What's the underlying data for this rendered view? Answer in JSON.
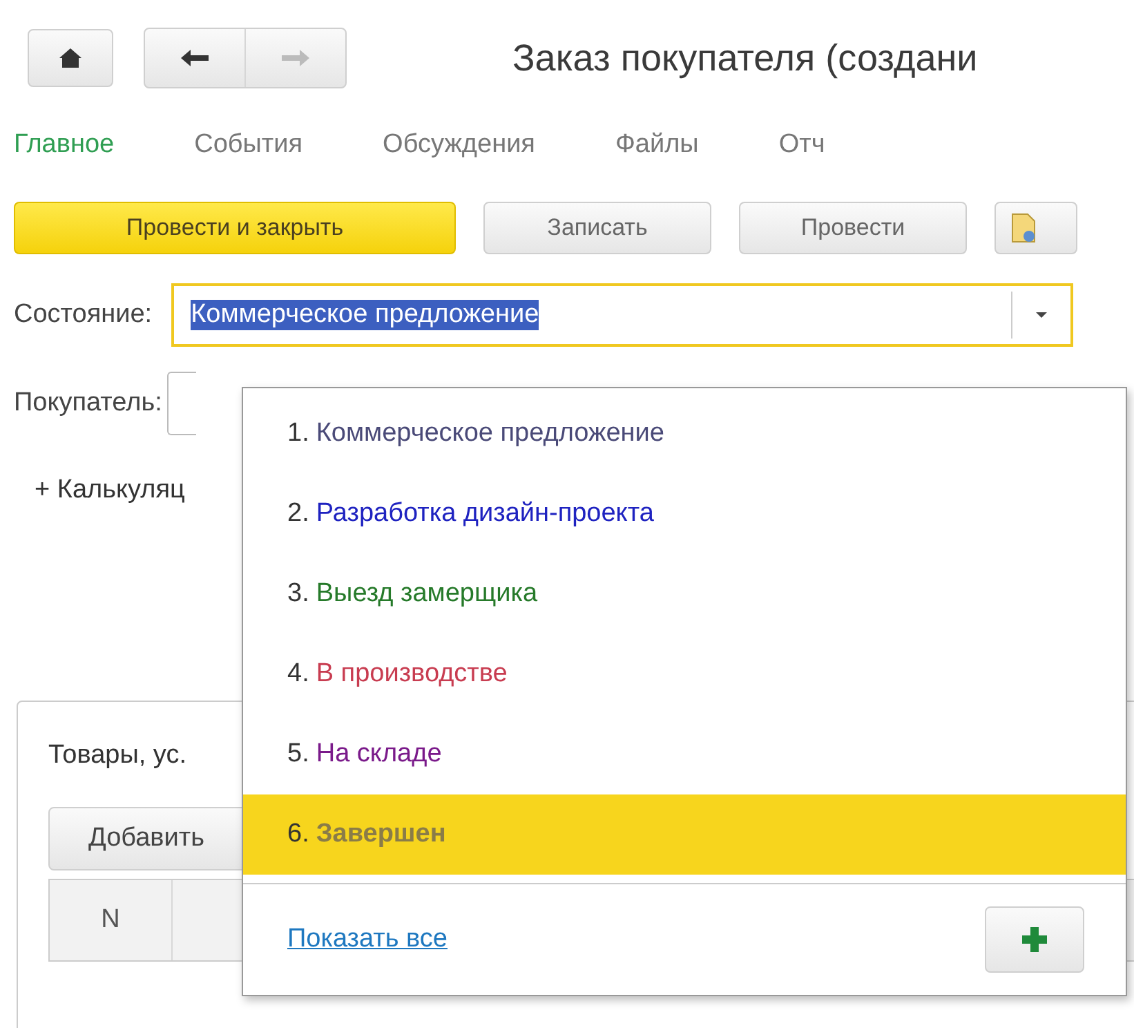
{
  "window": {
    "title": "Заказ покупателя (создани"
  },
  "nav": [
    {
      "label": "Главное",
      "selected": true
    },
    {
      "label": "События",
      "selected": false
    },
    {
      "label": "Обсуждения",
      "selected": false
    },
    {
      "label": "Файлы",
      "selected": false
    },
    {
      "label": "Отч",
      "selected": false
    }
  ],
  "toolbar": [
    {
      "label": "Провести и закрыть",
      "kind": "primary"
    },
    {
      "label": "Записать",
      "kind": "plain"
    },
    {
      "label": "Провести",
      "kind": "plain"
    },
    {
      "kind": "icon"
    }
  ],
  "state_field": {
    "label": "Состояние:",
    "value": "Коммерческое предложение"
  },
  "customer_field": {
    "label": "Покупатель:"
  },
  "calc_link": "+ Калькуляц",
  "panel": {
    "tab": "Товары, ус.",
    "add_button": "Добавить",
    "columns": [
      "N"
    ]
  },
  "dropdown": {
    "items": [
      {
        "number": "1.",
        "label": "Коммерческое предложение",
        "color": "#4a4a78",
        "selected": false
      },
      {
        "number": "2.",
        "label": "Разработка дизайн-проекта",
        "color": "#1e22c0",
        "selected": false
      },
      {
        "number": "3.",
        "label": "Выезд замерщика",
        "color": "#267a2a",
        "selected": false
      },
      {
        "number": "4.",
        "label": "В производстве",
        "color": "#c83c50",
        "selected": false
      },
      {
        "number": "5.",
        "label": "На складе",
        "color": "#7a1a8a",
        "selected": false
      },
      {
        "number": "6.",
        "label": "Завершен",
        "color": "#8a7c48",
        "selected": true
      }
    ],
    "show_all": "Показать все"
  }
}
